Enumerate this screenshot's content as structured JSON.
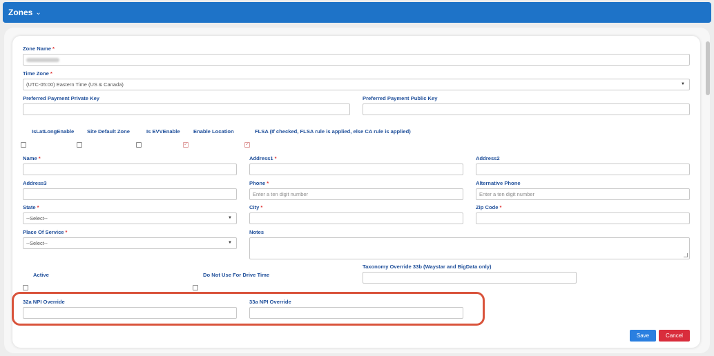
{
  "header": {
    "title": "Zones",
    "chevron_icon": "chevron-down-icon"
  },
  "form": {
    "zone_name": {
      "label": "Zone Name",
      "required": "*"
    },
    "time_zone": {
      "label": "Time Zone",
      "required": "*",
      "value": "(UTC-05:00) Eastern Time (US & Canada)"
    },
    "preferred_private_key": {
      "label": "Preferred Payment Private Key",
      "value": ""
    },
    "preferred_public_key": {
      "label": "Preferred Payment Public Key",
      "value": ""
    },
    "checkboxes_top": {
      "is_lat_long": {
        "label": "IsLatLongEnable",
        "checked": false
      },
      "site_default_zone": {
        "label": "Site Default Zone",
        "checked": false
      },
      "is_evv": {
        "label": "Is EVVEnable",
        "checked": false
      },
      "enable_location": {
        "label": "Enable Location",
        "checked": true
      },
      "flsa": {
        "label": "FLSA (If checked, FLSA rule is applied, else CA rule is applied)",
        "checked": true
      }
    },
    "name": {
      "label": "Name",
      "required": "*",
      "value": ""
    },
    "address1": {
      "label": "Address1",
      "required": "*",
      "value": ""
    },
    "address2": {
      "label": "Address2",
      "value": ""
    },
    "address3": {
      "label": "Address3",
      "value": ""
    },
    "phone": {
      "label": "Phone",
      "required": "*",
      "placeholder": "Enter a ten digit number"
    },
    "alt_phone": {
      "label": "Alternative Phone",
      "placeholder": "Enter a ten digit number"
    },
    "state": {
      "label": "State",
      "required": "*",
      "value": "--Select--"
    },
    "city": {
      "label": "City",
      "required": "*",
      "value": ""
    },
    "zip": {
      "label": "Zip Code",
      "required": "*",
      "value": ""
    },
    "place_of_service": {
      "label": "Place Of Service",
      "required": "*",
      "value": "--Select--"
    },
    "notes": {
      "label": "Notes",
      "value": ""
    },
    "active": {
      "label": "Active",
      "checked": false
    },
    "do_not_use_drive": {
      "label": "Do Not Use For Drive Time",
      "checked": false
    },
    "taxonomy_override": {
      "label": "Taxonomy Override 33b (Waystar and BigData only)",
      "value": ""
    },
    "npi_32a": {
      "label": "32a NPI Override",
      "value": ""
    },
    "npi_33a": {
      "label": "33a NPI Override",
      "value": ""
    }
  },
  "actions": {
    "save": "Save",
    "cancel": "Cancel"
  },
  "colors": {
    "header": "#1e73c8",
    "label": "#1f4f9a",
    "highlight": "#d9533b",
    "save": "#2a7fe0",
    "cancel": "#d92d3c"
  }
}
